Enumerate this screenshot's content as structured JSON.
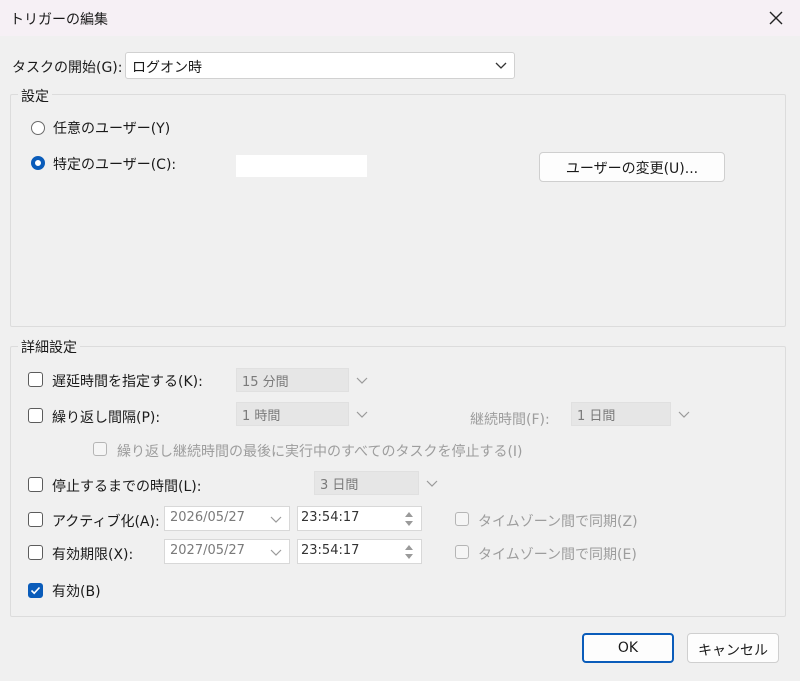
{
  "window": {
    "title": "トリガーの編集"
  },
  "start_task": {
    "label": "タスクの開始(G):",
    "value": "ログオン時"
  },
  "settings": {
    "title": "設定",
    "any_user_label": "任意のユーザー(Y)",
    "specific_user_label": "特定のユーザー(C):",
    "specific_user_value": "",
    "change_user_button": "ユーザーの変更(U)...",
    "selected": "specific_user"
  },
  "advanced": {
    "title": "詳細設定",
    "delay": {
      "label": "遅延時間を指定する(K):",
      "value": "15 分間",
      "checked": false
    },
    "repeat": {
      "label": "繰り返し間隔(P):",
      "value": "1 時間",
      "checked": false,
      "duration_label": "継続時間(F):",
      "duration_value": "1 日間"
    },
    "stop_running_label": "繰り返し継続時間の最後に実行中のすべてのタスクを停止する(I)",
    "stop_after": {
      "label": "停止するまでの時間(L):",
      "value": "3 日間",
      "checked": false
    },
    "activate": {
      "label": "アクティブ化(A):",
      "date": "2026/05/27",
      "time": "23:54:17",
      "sync_label": "タイムゾーン間で同期(Z)",
      "checked": false
    },
    "expire": {
      "label": "有効期限(X):",
      "date": "2027/05/27",
      "time": "23:54:17",
      "sync_label": "タイムゾーン間で同期(E)",
      "checked": false
    },
    "enabled": {
      "label": "有効(B)",
      "checked": true
    }
  },
  "buttons": {
    "ok": "OK",
    "cancel": "キャンセル"
  },
  "colors": {
    "accent": "#0a5cba",
    "titlebar": "#f6f0f5",
    "background": "#f0f0f0"
  }
}
